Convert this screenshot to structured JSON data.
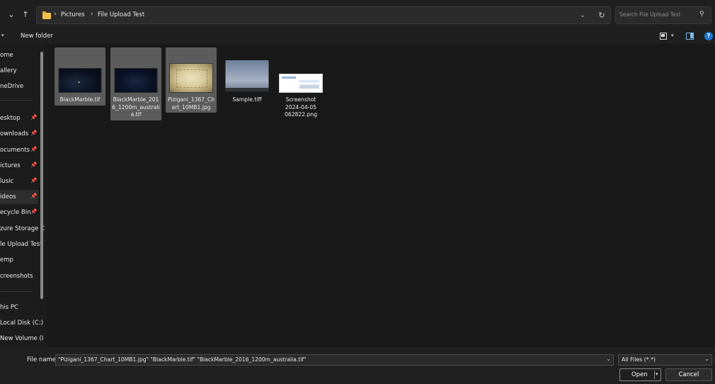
{
  "address_bar": {
    "breadcrumbs": [
      "Pictures",
      "File Upload Test"
    ],
    "search_placeholder": "Search File Upload Test",
    "icons": {
      "back": "chevron-down-icon",
      "up": "arrow-up-icon",
      "refresh": "refresh-icon",
      "search": "search-icon"
    }
  },
  "command_bar": {
    "new_folder_label": "New folder",
    "icons": {
      "view": "view-icon",
      "preview_pane": "preview-pane-icon",
      "help": "help-icon"
    }
  },
  "sidebar": {
    "items": [
      {
        "label": "ome",
        "pinned": false
      },
      {
        "label": "allery",
        "pinned": false
      },
      {
        "label": "neDrive",
        "pinned": false
      },
      {
        "label": "esktop",
        "pinned": true
      },
      {
        "label": "ownloads",
        "pinned": true
      },
      {
        "label": "ocuments",
        "pinned": true
      },
      {
        "label": "ictures",
        "pinned": true
      },
      {
        "label": "lusic",
        "pinned": true
      },
      {
        "label": "ideos",
        "pinned": true,
        "active": true
      },
      {
        "label": "ecycle Bin",
        "pinned": true
      },
      {
        "label": "zure Storage C",
        "pinned": false
      },
      {
        "label": "le Upload Test",
        "pinned": false
      },
      {
        "label": "emp",
        "pinned": false
      },
      {
        "label": "creenshots",
        "pinned": false
      },
      {
        "label": "his PC",
        "pinned": false
      },
      {
        "label": "Local Disk (C:)",
        "pinned": false
      },
      {
        "label": "New Volume (I",
        "pinned": false
      }
    ]
  },
  "files": [
    {
      "name": "BlackMarble.tif",
      "selected": true
    },
    {
      "name": "BlackMarble_2016_1200m_australia.tif",
      "selected": true
    },
    {
      "name": "Pizigani_1367_Chart_10MB1.jpg",
      "selected": true
    },
    {
      "name": "Sample.tiff",
      "selected": false
    },
    {
      "name": "Screenshot 2024-04-05 062822.png",
      "selected": false
    }
  ],
  "bottom_bar": {
    "file_name_label": "File name:",
    "file_name_value": "\"Pizigani_1367_Chart_10MB1.jpg\" \"BlackMarble.tif\" \"BlackMarble_2016_1200m_australia.tif\"",
    "file_type_value": "All Files (*.*)",
    "open_label": "Open",
    "cancel_label": "Cancel"
  },
  "colors": {
    "background": "#191919",
    "selection": "#5c5c5c",
    "folder": "#f2c14e",
    "accent": "#1e78d6"
  }
}
